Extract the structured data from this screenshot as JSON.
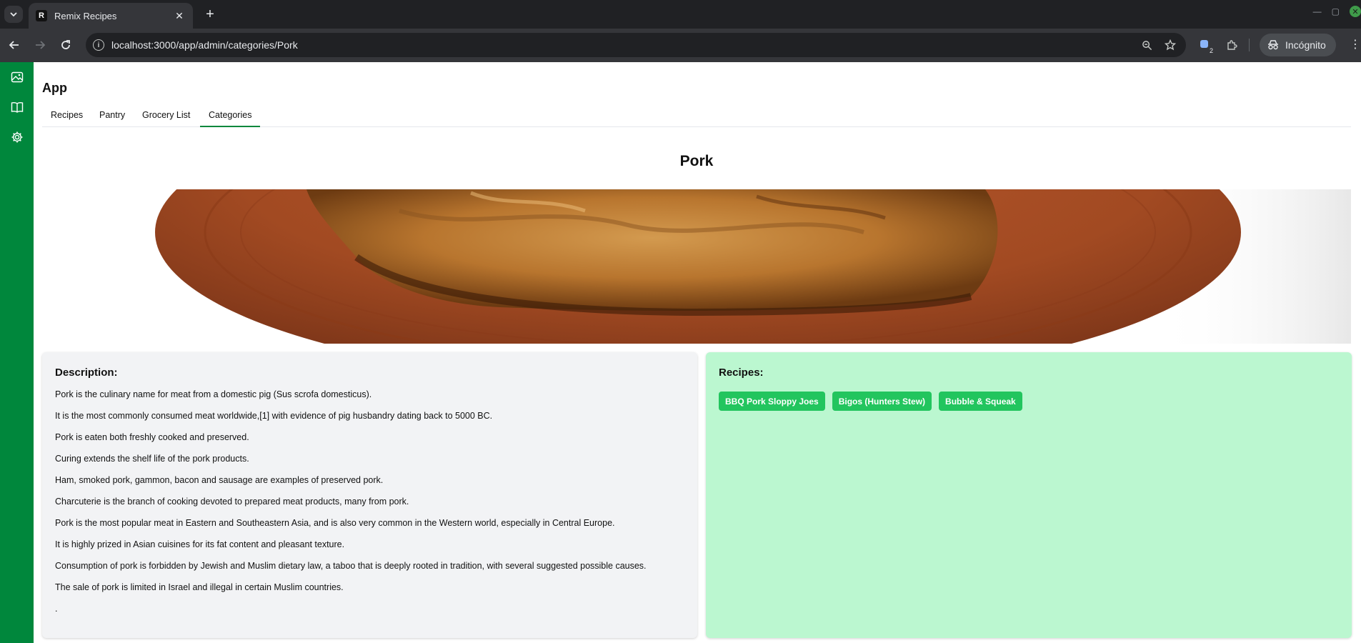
{
  "browser": {
    "tab_title": "Remix Recipes",
    "favicon_letter": "R",
    "url": "localhost:3000/app/admin/categories/Pork",
    "incognito_label": "Incógnito",
    "extension_badge": "2"
  },
  "app": {
    "title": "App",
    "nav": [
      {
        "label": "Recipes"
      },
      {
        "label": "Pantry"
      },
      {
        "label": "Grocery List"
      },
      {
        "label": "Categories",
        "active": true
      }
    ],
    "sidebar_icons": [
      "image-icon",
      "book-icon",
      "gear-icon"
    ],
    "accent_color": "#00873c"
  },
  "category": {
    "name": "Pork",
    "description_heading": "Description:",
    "description_lines": [
      "Pork is the culinary name for meat from a domestic pig (Sus scrofa domesticus).",
      "It is the most commonly consumed meat worldwide,[1] with evidence of pig husbandry dating back to 5000 BC.",
      "Pork is eaten both freshly cooked and preserved.",
      "Curing extends the shelf life of the pork products.",
      "Ham, smoked pork, gammon, bacon and sausage are examples of preserved pork.",
      "Charcuterie is the branch of cooking devoted to prepared meat products, many from pork.",
      "Pork is the most popular meat in Eastern and Southeastern Asia, and is also very common in the Western world, especially in Central Europe.",
      "It is highly prized in Asian cuisines for its fat content and pleasant texture.",
      "Consumption of pork is forbidden by Jewish and Muslim dietary law, a taboo that is deeply rooted in tradition, with several suggested possible causes.",
      "The sale of pork is limited in Israel and illegal in certain Muslim countries.",
      "."
    ],
    "recipes_heading": "Recipes:",
    "recipes": [
      "BBQ Pork Sloppy Joes",
      "Bigos (Hunters Stew)",
      "Bubble & Squeak"
    ]
  }
}
